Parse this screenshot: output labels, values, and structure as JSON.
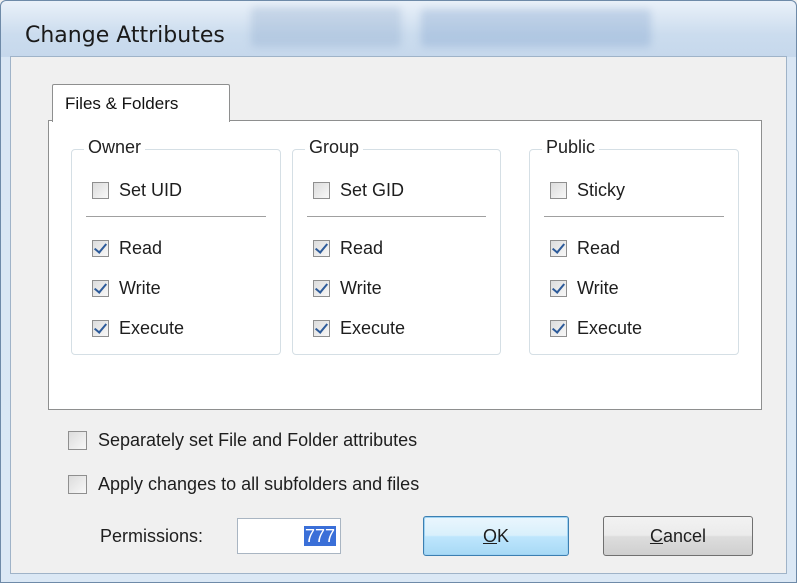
{
  "window": {
    "title": "Change Attributes"
  },
  "tab": {
    "label": "Files & Folders"
  },
  "groups": [
    {
      "title": "Owner",
      "special": {
        "label": "Set UID",
        "checked": false
      },
      "perms": [
        {
          "label": "Read",
          "checked": true
        },
        {
          "label": "Write",
          "checked": true
        },
        {
          "label": "Execute",
          "checked": true
        }
      ]
    },
    {
      "title": "Group",
      "special": {
        "label": "Set GID",
        "checked": false
      },
      "perms": [
        {
          "label": "Read",
          "checked": true
        },
        {
          "label": "Write",
          "checked": true
        },
        {
          "label": "Execute",
          "checked": true
        }
      ]
    },
    {
      "title": "Public",
      "special": {
        "label": "Sticky",
        "checked": false
      },
      "perms": [
        {
          "label": "Read",
          "checked": true
        },
        {
          "label": "Write",
          "checked": true
        },
        {
          "label": "Execute",
          "checked": true
        }
      ]
    }
  ],
  "options": {
    "separate": {
      "label": "Separately set File and Folder attributes",
      "checked": false
    },
    "recursive": {
      "label": "Apply changes to all subfolders and files",
      "checked": false
    }
  },
  "permissions": {
    "label": "Permissions:",
    "value": "777"
  },
  "buttons": {
    "ok": "OK",
    "ok_key": "O",
    "ok_rest": "K",
    "cancel_key": "C",
    "cancel_rest": "ancel"
  },
  "colors": {
    "check": "#2d5b9a",
    "selection": "#3a6fd8",
    "ok_border": "#3c7fb1"
  }
}
